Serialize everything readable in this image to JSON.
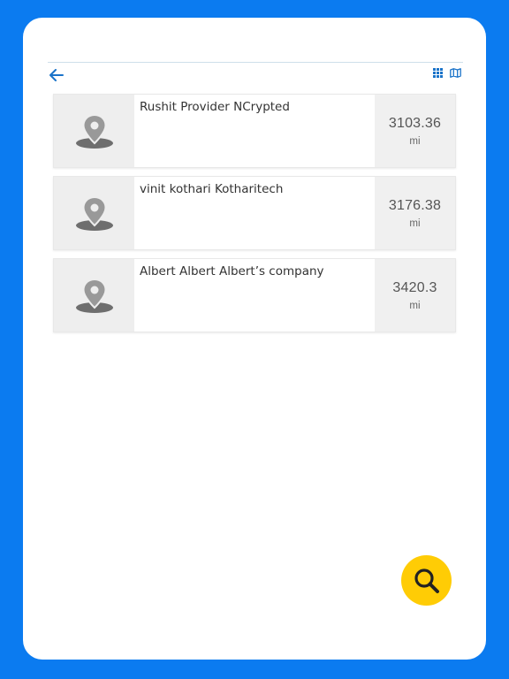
{
  "colors": {
    "frame": "#0b7bf0",
    "accent": "#1a73c9",
    "fab": "#ffcc05"
  },
  "icons": {
    "back": "arrow-left-icon",
    "grid": "grid-view-icon",
    "map": "map-view-icon",
    "location": "map-pin-icon",
    "search": "search-icon"
  },
  "results": [
    {
      "name": "Rushit Provider NCrypted",
      "distance": "3103.36",
      "unit": "mi"
    },
    {
      "name": "vinit kothari Kotharitech",
      "distance": "3176.38",
      "unit": "mi"
    },
    {
      "name": "Albert Albert Albert’s company",
      "distance": "3420.3",
      "unit": "mi"
    }
  ]
}
